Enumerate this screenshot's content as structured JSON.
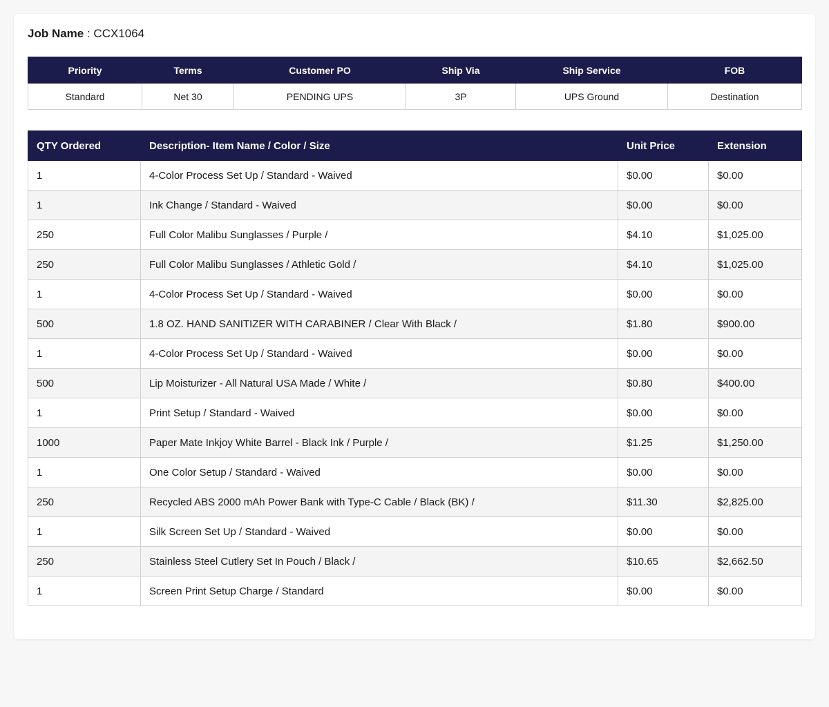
{
  "job": {
    "label": "Job Name",
    "separator": " : ",
    "value": "CCX1064"
  },
  "meta": {
    "headers": [
      "Priority",
      "Terms",
      "Customer PO",
      "Ship Via",
      "Ship Service",
      "FOB"
    ],
    "values": [
      "Standard",
      "Net 30",
      "PENDING UPS",
      "3P",
      "UPS Ground",
      "Destination"
    ]
  },
  "items": {
    "headers": [
      "QTY Ordered",
      "Description- Item Name / Color / Size",
      "Unit Price",
      "Extension"
    ],
    "rows": [
      {
        "qty": "1",
        "desc": "4-Color Process Set Up / Standard - Waived",
        "price": "$0.00",
        "ext": "$0.00"
      },
      {
        "qty": "1",
        "desc": "Ink Change / Standard - Waived",
        "price": "$0.00",
        "ext": "$0.00"
      },
      {
        "qty": "250",
        "desc": "Full Color Malibu Sunglasses / Purple /",
        "price": "$4.10",
        "ext": "$1,025.00"
      },
      {
        "qty": "250",
        "desc": "Full Color Malibu Sunglasses / Athletic Gold /",
        "price": "$4.10",
        "ext": "$1,025.00"
      },
      {
        "qty": "1",
        "desc": "4-Color Process Set Up / Standard - Waived",
        "price": "$0.00",
        "ext": "$0.00"
      },
      {
        "qty": "500",
        "desc": "1.8 OZ. HAND SANITIZER WITH CARABINER / Clear With Black /",
        "price": "$1.80",
        "ext": "$900.00"
      },
      {
        "qty": "1",
        "desc": "4-Color Process Set Up / Standard - Waived",
        "price": "$0.00",
        "ext": "$0.00"
      },
      {
        "qty": "500",
        "desc": "Lip Moisturizer - All Natural USA Made / White /",
        "price": "$0.80",
        "ext": "$400.00"
      },
      {
        "qty": "1",
        "desc": "Print Setup / Standard - Waived",
        "price": "$0.00",
        "ext": "$0.00"
      },
      {
        "qty": "1000",
        "desc": "Paper Mate Inkjoy White Barrel - Black Ink / Purple /",
        "price": "$1.25",
        "ext": "$1,250.00"
      },
      {
        "qty": "1",
        "desc": "One Color Setup / Standard - Waived",
        "price": "$0.00",
        "ext": "$0.00"
      },
      {
        "qty": "250",
        "desc": "Recycled ABS 2000 mAh Power Bank with Type-C Cable / Black (BK) /",
        "price": "$11.30",
        "ext": "$2,825.00"
      },
      {
        "qty": "1",
        "desc": "Silk Screen Set Up / Standard - Waived",
        "price": "$0.00",
        "ext": "$0.00"
      },
      {
        "qty": "250",
        "desc": "Stainless Steel Cutlery Set In Pouch / Black /",
        "price": "$10.65",
        "ext": "$2,662.50"
      },
      {
        "qty": "1",
        "desc": "Screen Print Setup Charge / Standard",
        "price": "$0.00",
        "ext": "$0.00"
      }
    ]
  },
  "colors": {
    "header_bg": "#1c1c4c",
    "header_text": "#ffffff",
    "alt_row_bg": "#f4f4f4",
    "page_bg": "#f7f7f7"
  }
}
